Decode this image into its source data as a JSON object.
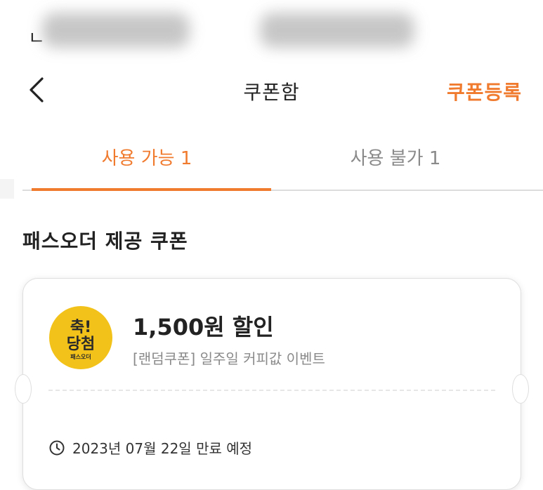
{
  "status_bar": {
    "left_text": "ㄴ"
  },
  "header": {
    "title": "쿠폰함",
    "register_label": "쿠폰등록",
    "back_icon": "chevron-left-icon"
  },
  "tabs": [
    {
      "label": "사용 가능 1",
      "active": true
    },
    {
      "label": "사용 불가 1",
      "active": false
    }
  ],
  "section": {
    "title": "패스오더 제공 쿠폰"
  },
  "coupon": {
    "badge_line1": "축!",
    "badge_line2": "당첨",
    "badge_brand": "패스오더",
    "amount": "1,500원 할인",
    "description": "[랜덤쿠폰] 일주일 커피값 이벤트",
    "expiry": "2023년 07월 22일 만료 예정"
  },
  "colors": {
    "accent": "#f07a2e",
    "badge_yellow": "#f2c21a",
    "text_dark": "#222222",
    "text_gray": "#8a8a8a"
  }
}
